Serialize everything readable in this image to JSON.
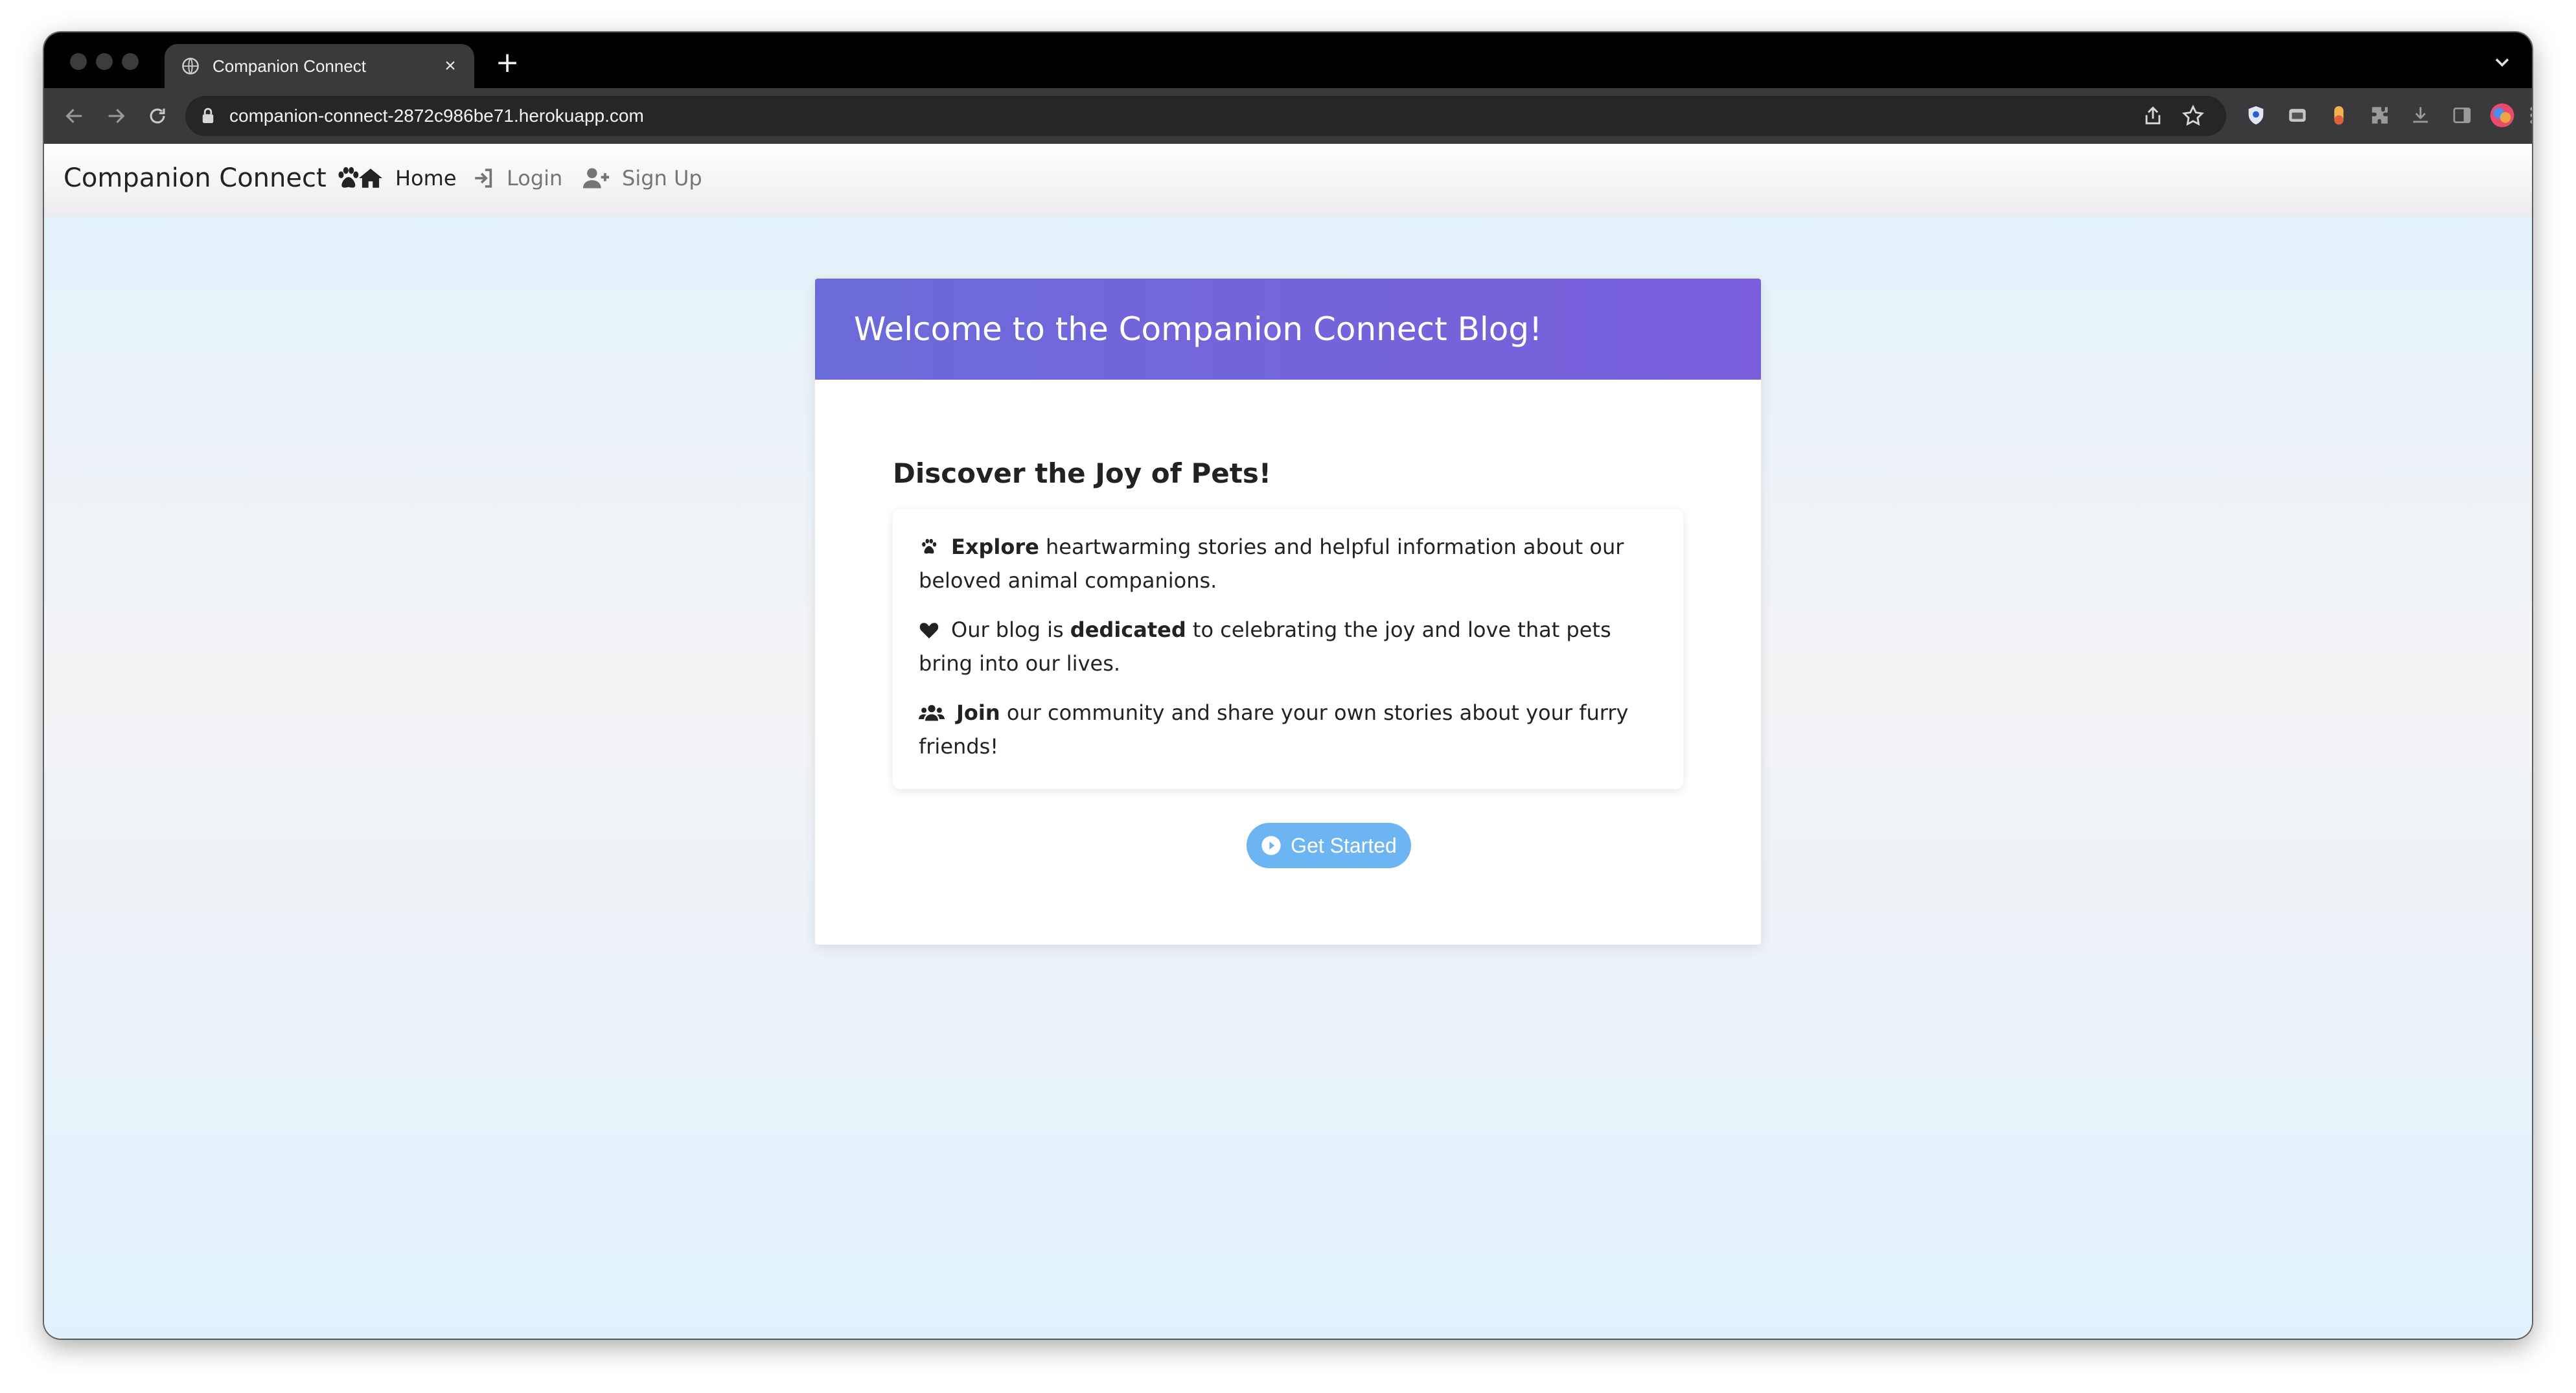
{
  "browser": {
    "tab_title": "Companion Connect",
    "tab_close": "×",
    "new_tab": "+",
    "url": "companion-connect-2872c986be71.herokuapp.com"
  },
  "navbar": {
    "brand": "Companion Connect",
    "links": [
      {
        "label": "Home",
        "icon": "home-icon"
      },
      {
        "label": "Login",
        "icon": "sign-in-icon"
      },
      {
        "label": "Sign Up",
        "icon": "user-plus-icon"
      }
    ]
  },
  "card": {
    "header": "Welcome to the Companion Connect Blog!",
    "subtitle": "Discover the Joy of Pets!",
    "items": [
      {
        "icon": "paw-icon",
        "before": "",
        "bold": "Explore",
        "after": " heartwarming stories and helpful information about our beloved animal companions."
      },
      {
        "icon": "heart-icon",
        "before": "Our blog is ",
        "bold": "dedicated",
        "after": " to celebrating the joy and love that pets bring into our lives."
      },
      {
        "icon": "users-icon",
        "before": "",
        "bold": "Join",
        "after": " our community and share your own stories about your furry friends!"
      }
    ],
    "cta": "Get Started"
  },
  "colors": {
    "header_gradient_start": "#6b6ad9",
    "header_gradient_end": "#7b5fdc",
    "cta_background": "#6cb5f2",
    "page_background": "#e2f2fb"
  }
}
